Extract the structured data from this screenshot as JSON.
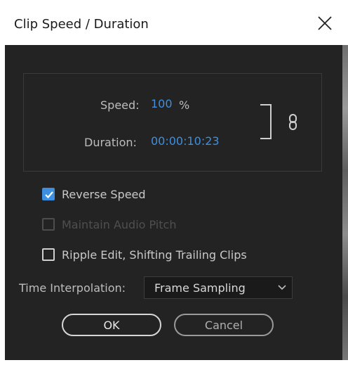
{
  "window": {
    "title": "Clip Speed / Duration"
  },
  "speed": {
    "label": "Speed:",
    "value": "100",
    "unit": "%"
  },
  "duration": {
    "label": "Duration:",
    "value": "00:00:10:23"
  },
  "options": {
    "reverse_speed": {
      "label": "Reverse Speed",
      "checked": true,
      "enabled": true
    },
    "maintain_audio_pitch": {
      "label": "Maintain Audio Pitch",
      "checked": false,
      "enabled": false
    },
    "ripple_edit": {
      "label": "Ripple Edit, Shifting Trailing Clips",
      "checked": false,
      "enabled": true
    }
  },
  "interpolation": {
    "label": "Time Interpolation:",
    "selected": "Frame Sampling"
  },
  "buttons": {
    "ok": "OK",
    "cancel": "Cancel"
  },
  "colors": {
    "accent": "#3f8fe0",
    "panel_bg": "#232323"
  },
  "icons": {
    "close": "close-icon",
    "link": "link-icon",
    "checkmark": "checkmark-icon",
    "dropdown": "chevron-down-icon"
  }
}
